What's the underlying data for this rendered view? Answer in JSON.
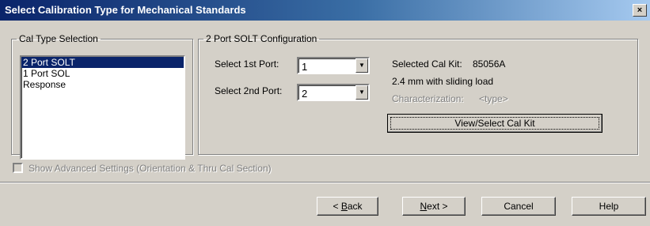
{
  "window": {
    "title": "Select Calibration Type for Mechanical Standards",
    "close_glyph": "×"
  },
  "cal_type": {
    "legend": "Cal Type Selection",
    "items": [
      {
        "label": "2 Port SOLT",
        "selected": true
      },
      {
        "label": "1 Port SOL",
        "selected": false
      },
      {
        "label": "Response",
        "selected": false
      }
    ]
  },
  "port_config": {
    "legend": "2 Port SOLT Configuration",
    "first_port_label": "Select 1st Port:",
    "first_port_value": "1",
    "second_port_label": "Select 2nd Port:",
    "second_port_value": "2",
    "cal_kit_label": "Selected Cal Kit:",
    "cal_kit_value": "85056A",
    "cal_kit_description": "2.4 mm with sliding load",
    "characterization_label": "Characterization:",
    "characterization_value": "<type>",
    "view_select_button": "View/Select Cal Kit"
  },
  "advanced": {
    "label": "Show Advanced Settings (Orientation & Thru Cal Section)",
    "checked": false,
    "enabled": false
  },
  "footer": {
    "back_prefix": "< ",
    "back_key": "B",
    "back_rest": "ack",
    "next_key": "N",
    "next_rest": "ext >",
    "cancel": "Cancel",
    "help": "Help"
  },
  "icons": {
    "dropdown_arrow": "chevron-down-icon",
    "close": "close-icon"
  },
  "colors": {
    "title_start": "#0a246a",
    "title_end": "#a6caf0",
    "selection": "#0a246a",
    "face": "#d4d0c8"
  }
}
